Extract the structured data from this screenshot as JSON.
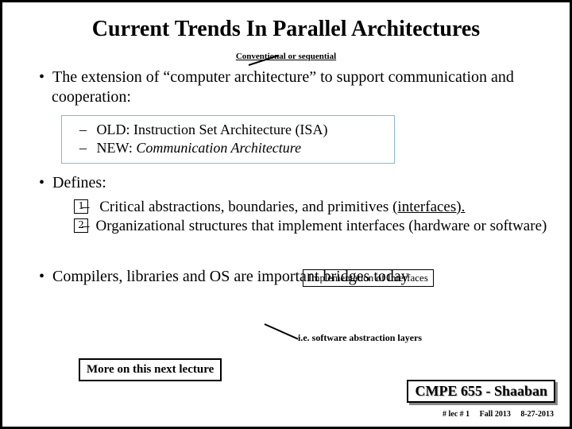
{
  "title": "Current Trends In Parallel Architectures",
  "annot_top": "Conventional or sequential",
  "b1": "The extension of “computer architecture” to support communication and cooperation:",
  "sub_old_prefix": "OLD:  ",
  "sub_old": "Instruction Set Architecture (ISA)",
  "sub_new_prefix": "NEW: ",
  "sub_new": "Communication Architecture",
  "b2": "Defines:",
  "num1": "1",
  "num2": "2",
  "def1a": "Critical abstractions, boundaries, and primitives ",
  "def1b": "(interfaces).",
  "def2": "Organizational structures that implement interfaces (hardware or software)",
  "impl": "Implementation of Interfaces",
  "b3": "Compilers, libraries and OS are important bridges today",
  "annot_mid": "i.e. software abstraction layers",
  "more": "More on this next lecture",
  "course": "CMPE 655 - Shaaban",
  "footer_lec": "#  lec # 1",
  "footer_term": "Fall 2013",
  "footer_date": "8-27-2013"
}
